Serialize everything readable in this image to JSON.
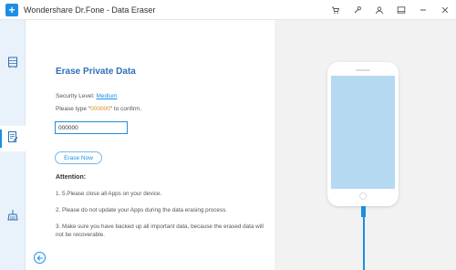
{
  "window": {
    "title": "Wondershare Dr.Fone - Data Eraser",
    "icons": [
      "cart-icon",
      "tool-icon",
      "account-icon",
      "feedback-icon",
      "minimize-icon",
      "close-icon"
    ]
  },
  "sidebar": {
    "items": [
      {
        "name": "erase-all-data",
        "icon": "storage-icon",
        "active": false
      },
      {
        "name": "erase-private-data",
        "icon": "document-erase-icon",
        "active": true
      },
      {
        "name": "free-up-space",
        "icon": "broom-icon",
        "active": false
      }
    ]
  },
  "main": {
    "heading": "Erase Private Data",
    "security_level_prefix": "Security Level: ",
    "security_level_value": "Medium",
    "instruction_prefix": "Please type \"",
    "instruction_code": "000000",
    "instruction_suffix": "\" to confirm.",
    "confirm_input_value": "000000",
    "erase_button_label": "Erase Now",
    "attention_title": "Attention:",
    "notes": [
      "1. 5.Please close all Apps on your device.",
      "2. Please do not update your Apps during the data erasing process.",
      "3. Make sure you have backed up all important data, because the erased data will not be recoverable."
    ]
  },
  "colors": {
    "accent": "#1a8fe3",
    "heading": "#2f6fb8",
    "code": "#e08a1e",
    "sidebar_bg": "#e9f2fb",
    "panel_bg": "#f2f2f2",
    "screen": "#b5d9f1"
  }
}
